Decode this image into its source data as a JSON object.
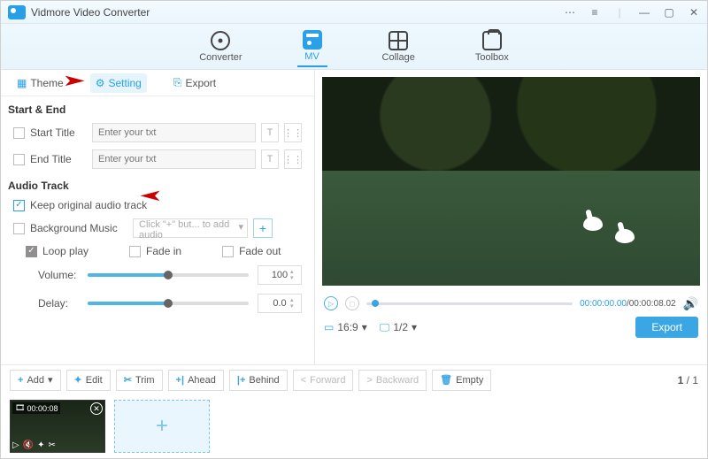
{
  "app": {
    "title": "Vidmore Video Converter"
  },
  "main_tabs": {
    "converter": "Converter",
    "mv": "MV",
    "collage": "Collage",
    "toolbox": "Toolbox"
  },
  "subtabs": {
    "theme": "Theme",
    "setting": "Setting",
    "export": "Export"
  },
  "sections": {
    "start_end": "Start & End",
    "start_title": "Start Title",
    "end_title": "End Title",
    "placeholder": "Enter your txt",
    "audio_track": "Audio Track",
    "keep_original": "Keep original audio track",
    "bg_music": "Background Music",
    "bg_placeholder": "Click \"+\" but... to add audio",
    "loop": "Loop play",
    "fadein": "Fade in",
    "fadeout": "Fade out",
    "volume": "Volume:",
    "delay": "Delay:",
    "vol_value": "100",
    "delay_value": "0.0"
  },
  "player": {
    "time_cur": "00:00:00.00",
    "time_total": "00:00:08.02",
    "aspect": "16:9",
    "ratio": "1/2",
    "export": "Export"
  },
  "bottom": {
    "add": "Add",
    "edit": "Edit",
    "trim": "Trim",
    "ahead": "Ahead",
    "behind": "Behind",
    "forward": "Forward",
    "backward": "Backward",
    "empty": "Empty",
    "page_cur": "1",
    "page_total": "1"
  },
  "thumb": {
    "duration": "00:00:08"
  }
}
